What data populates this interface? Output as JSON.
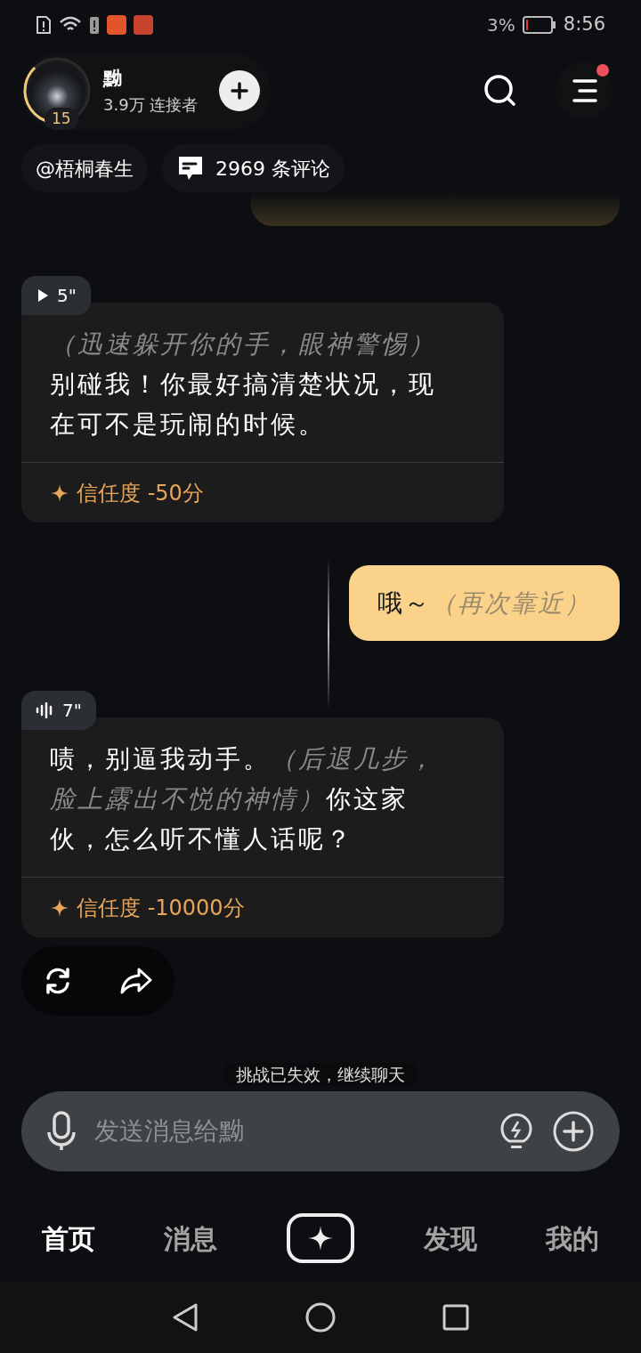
{
  "status_bar": {
    "battery": "3%",
    "time": "8:56"
  },
  "header": {
    "name": "黝",
    "followers": "3.9万 连接者",
    "level_badge": "15",
    "ring": {
      "level": 0.35
    },
    "menu_notification": true
  },
  "chips": [
    {
      "kind": "author",
      "label": "@梧桐春生"
    },
    {
      "kind": "comments",
      "label": "2969 条评论"
    }
  ],
  "messages": [
    {
      "kind": "bot",
      "audio": {
        "kind": "play",
        "duration": "5\""
      },
      "segments": [
        {
          "kind": "action",
          "text": "（迅速躲开你的手，眼神警惕）",
          "own_line": true
        },
        {
          "kind": "speech",
          "text": "别碰我！你最好搞清楚状况，现在可不是玩闹的时候。"
        }
      ],
      "trust": "信任度 -50分"
    },
    {
      "kind": "user",
      "segments": [
        {
          "kind": "speech",
          "text": "哦～"
        },
        {
          "kind": "action",
          "text": "（再次靠近）"
        }
      ]
    },
    {
      "kind": "bot",
      "audio": {
        "kind": "wave",
        "duration": "7\""
      },
      "segments": [
        {
          "kind": "speech",
          "text": "啧，别逼我动手。"
        },
        {
          "kind": "action",
          "text": "（后退几步，脸上露出不悦的神情）"
        },
        {
          "kind": "speech",
          "text": "你这家伙，怎么听不懂人话呢？"
        }
      ],
      "trust": "信任度 -10000分"
    }
  ],
  "notice": "挑战已失效，继续聊天",
  "input": {
    "placeholder": "发送消息给黝"
  },
  "tabs": [
    {
      "kind": "text",
      "label": "首页",
      "selected": true
    },
    {
      "kind": "text",
      "label": "消息",
      "selected": false
    },
    {
      "kind": "create",
      "selected": false
    },
    {
      "kind": "text",
      "label": "发现",
      "selected": false
    },
    {
      "kind": "text",
      "label": "我的",
      "selected": false
    }
  ]
}
